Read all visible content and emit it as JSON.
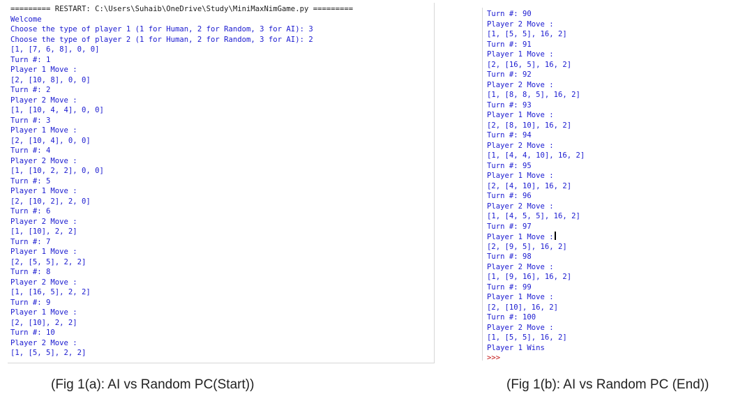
{
  "left_console": {
    "lines": [
      {
        "text": "========= RESTART: C:\\Users\\Suhaib\\OneDrive\\Study\\MiniMaxNimGame.py =========",
        "kind": "restart"
      },
      {
        "text": "Welcome",
        "kind": "output"
      },
      {
        "text": "Choose the type of player 1 (1 for Human, 2 for Random, 3 for AI): 3",
        "kind": "output"
      },
      {
        "text": "Choose the type of player 2 (1 for Human, 2 for Random, 3 for AI): 2",
        "kind": "output"
      },
      {
        "text": "[1, [7, 6, 8], 0, 0]",
        "kind": "output"
      },
      {
        "text": "Turn #: 1",
        "kind": "output"
      },
      {
        "text": "Player 1 Move :",
        "kind": "output"
      },
      {
        "text": "[2, [10, 8], 0, 0]",
        "kind": "output"
      },
      {
        "text": "Turn #: 2",
        "kind": "output"
      },
      {
        "text": "Player 2 Move :",
        "kind": "output"
      },
      {
        "text": "[1, [10, 4, 4], 0, 0]",
        "kind": "output"
      },
      {
        "text": "Turn #: 3",
        "kind": "output"
      },
      {
        "text": "Player 1 Move :",
        "kind": "output"
      },
      {
        "text": "[2, [10, 4], 0, 0]",
        "kind": "output"
      },
      {
        "text": "Turn #: 4",
        "kind": "output"
      },
      {
        "text": "Player 2 Move :",
        "kind": "output"
      },
      {
        "text": "[1, [10, 2, 2], 0, 0]",
        "kind": "output"
      },
      {
        "text": "Turn #: 5",
        "kind": "output"
      },
      {
        "text": "Player 1 Move :",
        "kind": "output"
      },
      {
        "text": "[2, [10, 2], 2, 0]",
        "kind": "output"
      },
      {
        "text": "Turn #: 6",
        "kind": "output"
      },
      {
        "text": "Player 2 Move :",
        "kind": "output"
      },
      {
        "text": "[1, [10], 2, 2]",
        "kind": "output"
      },
      {
        "text": "Turn #: 7",
        "kind": "output"
      },
      {
        "text": "Player 1 Move :",
        "kind": "output"
      },
      {
        "text": "[2, [5, 5], 2, 2]",
        "kind": "output"
      },
      {
        "text": "Turn #: 8",
        "kind": "output"
      },
      {
        "text": "Player 2 Move :",
        "kind": "output"
      },
      {
        "text": "[1, [16, 5], 2, 2]",
        "kind": "output"
      },
      {
        "text": "Turn #: 9",
        "kind": "output"
      },
      {
        "text": "Player 1 Move :",
        "kind": "output"
      },
      {
        "text": "[2, [10], 2, 2]",
        "kind": "output"
      },
      {
        "text": "Turn #: 10",
        "kind": "output"
      },
      {
        "text": "Player 2 Move :",
        "kind": "output"
      },
      {
        "text": "[1, [5, 5], 2, 2]",
        "kind": "output"
      }
    ]
  },
  "right_console": {
    "lines": [
      {
        "text": "Turn #: 90",
        "kind": "output"
      },
      {
        "text": "Player 2 Move :",
        "kind": "output"
      },
      {
        "text": "[1, [5, 5], 16, 2]",
        "kind": "output"
      },
      {
        "text": "Turn #: 91",
        "kind": "output"
      },
      {
        "text": "Player 1 Move :",
        "kind": "output"
      },
      {
        "text": "[2, [16, 5], 16, 2]",
        "kind": "output"
      },
      {
        "text": "Turn #: 92",
        "kind": "output"
      },
      {
        "text": "Player 2 Move :",
        "kind": "output"
      },
      {
        "text": "[1, [8, 8, 5], 16, 2]",
        "kind": "output"
      },
      {
        "text": "Turn #: 93",
        "kind": "output"
      },
      {
        "text": "Player 1 Move :",
        "kind": "output"
      },
      {
        "text": "[2, [8, 10], 16, 2]",
        "kind": "output"
      },
      {
        "text": "Turn #: 94",
        "kind": "output"
      },
      {
        "text": "Player 2 Move :",
        "kind": "output"
      },
      {
        "text": "[1, [4, 4, 10], 16, 2]",
        "kind": "output"
      },
      {
        "text": "Turn #: 95",
        "kind": "output"
      },
      {
        "text": "Player 1 Move :",
        "kind": "output"
      },
      {
        "text": "[2, [4, 10], 16, 2]",
        "kind": "output"
      },
      {
        "text": "Turn #: 96",
        "kind": "output"
      },
      {
        "text": "Player 2 Move :",
        "kind": "output"
      },
      {
        "text": "[1, [4, 5, 5], 16, 2]",
        "kind": "output"
      },
      {
        "text": "Turn #: 97",
        "kind": "output"
      },
      {
        "text": "Player 1 Move :",
        "kind": "output",
        "cursor": true
      },
      {
        "text": "[2, [9, 5], 16, 2]",
        "kind": "output"
      },
      {
        "text": "Turn #: 98",
        "kind": "output"
      },
      {
        "text": "Player 2 Move :",
        "kind": "output"
      },
      {
        "text": "[1, [9, 16], 16, 2]",
        "kind": "output"
      },
      {
        "text": "Turn #: 99",
        "kind": "output"
      },
      {
        "text": "Player 1 Move :",
        "kind": "output"
      },
      {
        "text": "[2, [10], 16, 2]",
        "kind": "output"
      },
      {
        "text": "Turn #: 100",
        "kind": "output"
      },
      {
        "text": "Player 2 Move :",
        "kind": "output"
      },
      {
        "text": "[1, [5, 5], 16, 2]",
        "kind": "output"
      },
      {
        "text": "Player 1 Wins",
        "kind": "output"
      },
      {
        "text": ">>>",
        "kind": "prompt"
      }
    ]
  },
  "captions": {
    "left": "(Fig 1(a): AI vs Random PC(Start))",
    "right": "(Fig 1(b): AI vs Random PC (End))"
  },
  "colors": {
    "output_text": "#1a1ad0",
    "restart_text": "#1a1a1a",
    "prompt_text": "#c31616"
  }
}
